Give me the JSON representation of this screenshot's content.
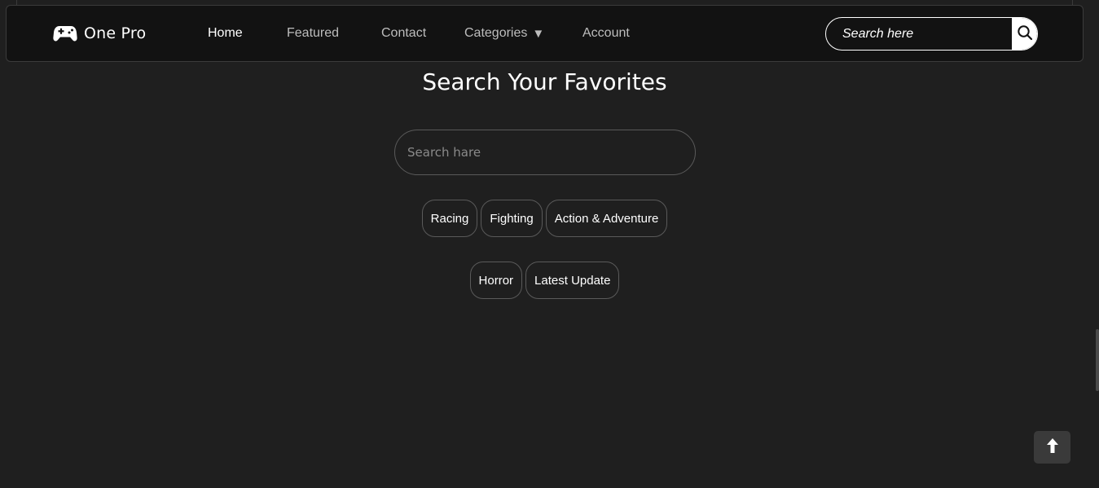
{
  "brand": {
    "name": "One Pro",
    "icon": "gamepad-icon"
  },
  "nav": {
    "items": [
      {
        "label": "Home",
        "active": true
      },
      {
        "label": "Featured"
      },
      {
        "label": "Contact"
      },
      {
        "label": "Categories",
        "caret": "▼"
      },
      {
        "label": "Account"
      }
    ],
    "search": {
      "placeholder": "Search here",
      "icon": "search-icon"
    }
  },
  "main": {
    "heading": "Search Your Favorites",
    "search": {
      "placeholder": "Search hare"
    },
    "chips_row1": [
      "Racing",
      "Fighting",
      "Action & Adventure"
    ],
    "chips_row2": [
      "Horror",
      "Latest Update"
    ]
  },
  "scroll_top": {
    "icon": "arrow-up-icon"
  },
  "colors": {
    "background": "#1f1f1f",
    "navbar": "#121212",
    "border": "#5a5a5a",
    "text": "#ffffff",
    "nav_inactive": "#bdbdbd"
  }
}
